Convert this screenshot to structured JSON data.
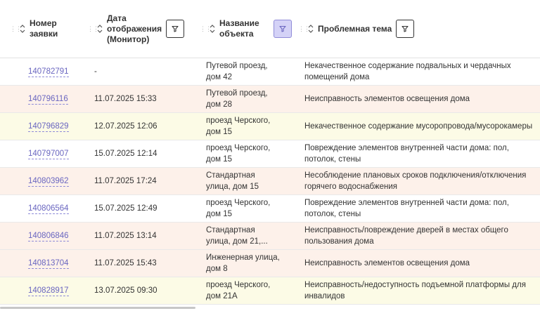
{
  "header": {
    "number": "Номер\nзаявки",
    "number_lines": [
      "Номер",
      "заявки"
    ],
    "date_lines": [
      "Дата",
      "отображения",
      "(Монитор)"
    ],
    "object_lines": [
      "Название",
      "объекта"
    ],
    "topic": "Проблемная тема"
  },
  "icons": {
    "drag": "drag-handle-icon",
    "sort": "sort-chevrons-icon",
    "filter": "filter-funnel-icon"
  },
  "colors": {
    "link": "#6a66c0",
    "row_pink": "#fdf1ea",
    "row_yellow": "#fcfbe6",
    "filter_active_bg": "#d4d2f7"
  },
  "rows": [
    {
      "number": "140782791",
      "date": "-",
      "object": [
        "Путевой проезд,",
        "дом 42"
      ],
      "topic": [
        "Некачественное содержание подвальных и чердачных",
        "помещений дома"
      ],
      "tone": "white"
    },
    {
      "number": "140796116",
      "date": "11.07.2025 15:33",
      "object": [
        "Путевой проезд,",
        "дом 28"
      ],
      "topic": [
        "Неисправность элементов освещения дома"
      ],
      "tone": "pink"
    },
    {
      "number": "140796829",
      "date": "12.07.2025 12:06",
      "object": [
        "проезд Черского,",
        "дом 15"
      ],
      "topic": [
        "Некачественное содержание мусоропровода/мусорокамеры"
      ],
      "tone": "yellow"
    },
    {
      "number": "140797007",
      "date": "15.07.2025 12:14",
      "object": [
        "проезд Черского,",
        "дом 15"
      ],
      "topic": [
        "Повреждение элементов внутренней части дома: пол,",
        "потолок, стены"
      ],
      "tone": "white"
    },
    {
      "number": "140803962",
      "date": "11.07.2025 17:24",
      "object": [
        "Стандартная",
        "улица, дом 15"
      ],
      "topic": [
        "Несоблюдение плановых сроков подключения/отключения",
        "горячего водоснабжения"
      ],
      "tone": "pink"
    },
    {
      "number": "140806564",
      "date": "15.07.2025 12:49",
      "object": [
        "проезд Черского,",
        "дом 15"
      ],
      "topic": [
        "Повреждение элементов внутренней части дома: пол,",
        "потолок, стены"
      ],
      "tone": "white"
    },
    {
      "number": "140806846",
      "date": "11.07.2025 13:14",
      "object": [
        "Стандартная",
        "улица, дом 21,..."
      ],
      "topic": [
        "Неисправность/повреждение дверей в местах общего",
        "пользования дома"
      ],
      "tone": "pink"
    },
    {
      "number": "140813704",
      "date": "11.07.2025 15:43",
      "object": [
        "Инженерная улица,",
        "дом 8"
      ],
      "topic": [
        "Неисправность элементов освещения дома"
      ],
      "tone": "pink"
    },
    {
      "number": "140828917",
      "date": "13.07.2025 09:30",
      "object": [
        "проезд Черского,",
        "дом 21А"
      ],
      "topic": [
        "Неисправность/недоступность подъемной платформы для",
        "инвалидов"
      ],
      "tone": "yellow"
    }
  ]
}
